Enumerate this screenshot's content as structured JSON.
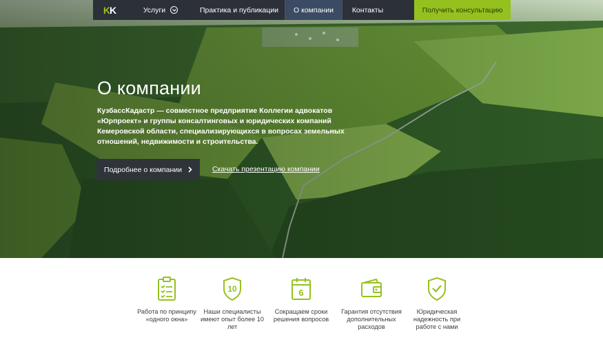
{
  "nav": {
    "logo_letter_1": "K",
    "logo_letter_2": "K",
    "items": [
      {
        "label": "Услуги"
      },
      {
        "label": "Практика и публикации"
      },
      {
        "label": "О компании"
      },
      {
        "label": "Контакты"
      }
    ],
    "active_item": "О компании",
    "cta_label": "Получить консультацию"
  },
  "hero": {
    "title": "О компании",
    "description": "КузбассКадастр — совместное предприятие Коллегии адвокатов «Юрпроект» и группы консалтинговых и юридических компаний Кемеровской области, специализирующихся в вопросах земельных отношений, недвижимости и строительства.",
    "primary_button_label": "Подробнее о компании",
    "link_label": "Скачать презентацию компании",
    "background": "aerial-forest-photo"
  },
  "features": [
    {
      "icon": "checklist-clipboard-icon",
      "label": "Работа по принципу «одного окна»"
    },
    {
      "icon": "shield-10-icon",
      "icon_text": "10",
      "label": "Наши специалисты имеют опыт более 10 лет"
    },
    {
      "icon": "calendar-6-icon",
      "icon_text": "6",
      "label": "Сокращаем сроки решения вопросов"
    },
    {
      "icon": "wallet-icon",
      "label": "Гарантия отсутствия дополнительных расходов"
    },
    {
      "icon": "shield-check-icon",
      "label": "Юридическая надежность при работе с нами"
    }
  ],
  "colors": {
    "accent_green": "#95c11f",
    "nav_dark": "#2c3038",
    "nav_active": "#3b4b63",
    "button_dark": "#2f343b",
    "text_dark": "#3d3d3d"
  }
}
